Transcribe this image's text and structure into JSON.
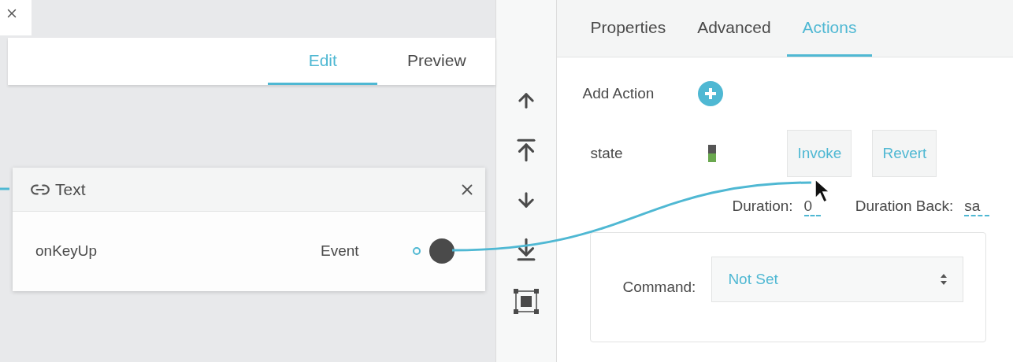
{
  "editor_tabs": [
    {
      "label": "Edit",
      "selected": true
    },
    {
      "label": "Preview",
      "selected": false
    }
  ],
  "node": {
    "title": "Text",
    "port": {
      "name": "onKeyUp",
      "type": "Event"
    }
  },
  "panel_tabs": [
    {
      "label": "Properties",
      "selected": false
    },
    {
      "label": "Advanced",
      "selected": false
    },
    {
      "label": "Actions",
      "selected": true
    }
  ],
  "add_action": {
    "label": "Add Action"
  },
  "action": {
    "name": "state",
    "buttons": [
      "Invoke",
      "Revert"
    ],
    "fields": [
      {
        "label": "Duration:",
        "value": "0"
      },
      {
        "label": "Duration Back:",
        "value": "sa"
      }
    ],
    "command": {
      "label": "Command:",
      "value": "Not Set"
    }
  }
}
